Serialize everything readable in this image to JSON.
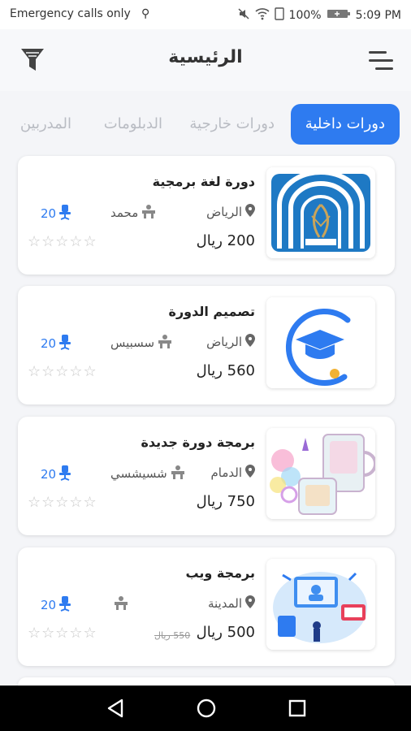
{
  "status": {
    "left_text": "Emergency calls only",
    "battery": "100%",
    "time": "5:09 PM"
  },
  "header": {
    "title": "الرئيسية",
    "filter_icon": "filter-icon",
    "menu_icon": "menu-icon"
  },
  "tabs": [
    {
      "label": "دورات داخلية",
      "active": true
    },
    {
      "label": "دورات خارجية",
      "active": false
    },
    {
      "label": "الدبلومات",
      "active": false
    },
    {
      "label": "المدربين",
      "active": false
    }
  ],
  "courses": [
    {
      "title": "دورة لغة برمجية",
      "location": "الرياض",
      "trainer": "محمد",
      "seats": "20",
      "price": "200 ريال",
      "old_price": "",
      "rating": 0
    },
    {
      "title": "تصميم الدورة",
      "location": "الرياض",
      "trainer": "سسبيس",
      "seats": "20",
      "price": "560 ريال",
      "old_price": "",
      "rating": 0
    },
    {
      "title": "برمجة دورة جديدة",
      "location": "الدمام",
      "trainer": "شسيشسي",
      "seats": "20",
      "price": "750 ريال",
      "old_price": "",
      "rating": 0
    },
    {
      "title": "برمجة ويب",
      "location": "المدينة",
      "trainer": "",
      "seats": "20",
      "price": "500 ريال",
      "old_price": "550 ريال",
      "rating": 0
    }
  ],
  "colors": {
    "accent": "#2e7bf0",
    "text": "#222222",
    "muted": "#b9bcc3"
  },
  "nav": {
    "back_icon": "back-icon",
    "home_icon": "home-icon",
    "recents_icon": "recents-icon"
  }
}
